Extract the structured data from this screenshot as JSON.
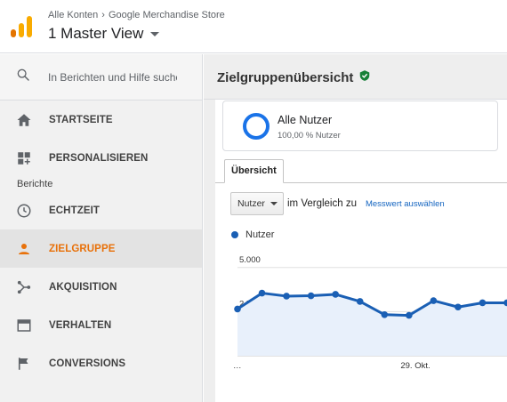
{
  "header": {
    "breadcrumb": [
      "Alle Konten",
      "Google Merchandise Store"
    ],
    "view_name": "1 Master View"
  },
  "sidebar": {
    "search_placeholder": "In Berichten und Hilfe suchen",
    "top_items": [
      {
        "label": "STARTSEITE",
        "icon": "home-icon"
      },
      {
        "label": "PERSONALISIEREN",
        "icon": "dashboard-plus-icon"
      }
    ],
    "section_label": "Berichte",
    "report_items": [
      {
        "label": "ECHTZEIT",
        "icon": "clock-icon"
      },
      {
        "label": "ZIELGRUPPE",
        "icon": "person-icon",
        "active": true
      },
      {
        "label": "AKQUISITION",
        "icon": "share-icon"
      },
      {
        "label": "VERHALTEN",
        "icon": "window-icon"
      },
      {
        "label": "CONVERSIONS",
        "icon": "flag-icon"
      }
    ]
  },
  "main": {
    "title": "Zielgruppenübersicht",
    "title_badge_icon": "verified-shield-icon",
    "segment": {
      "name": "Alle Nutzer",
      "sub": "100,00 % Nutzer"
    },
    "tab": "Übersicht",
    "metric_select": "Nutzer",
    "compare_text": "im Vergleich zu",
    "compare_link": "Messwert auswählen"
  },
  "colors": {
    "accent_orange": "#e8710a",
    "line_blue": "#1a5fb4",
    "fill_blue": "#e8f0fb"
  },
  "chart_data": {
    "type": "area",
    "series": [
      {
        "name": "Nutzer",
        "values": [
          2650,
          3550,
          3380,
          3400,
          3480,
          3080,
          2330,
          2290,
          3120,
          2760,
          3000,
          3000
        ]
      }
    ],
    "y_ticks": [
      "5.000",
      "2.500"
    ],
    "y_tick_values": [
      5000,
      2500
    ],
    "x_labels": [
      "…",
      "29. Okt."
    ],
    "ylim": [
      0,
      6200
    ],
    "grid": true
  }
}
